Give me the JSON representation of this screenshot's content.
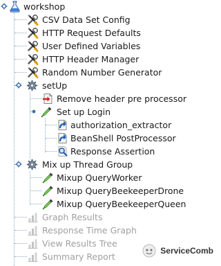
{
  "tree": {
    "root": {
      "label": "workshop",
      "icon": "flask-icon"
    },
    "items": [
      {
        "label": "CSV Data Set Config",
        "icon": "wrench-screwdriver-icon"
      },
      {
        "label": "HTTP Request Defaults",
        "icon": "wrench-screwdriver-icon"
      },
      {
        "label": "User Defined Variables",
        "icon": "wrench-screwdriver-icon"
      },
      {
        "label": "HTTP Header Manager",
        "icon": "wrench-screwdriver-icon"
      },
      {
        "label": "Random Number Generator",
        "icon": "wrench-screwdriver-icon"
      },
      {
        "label": "setUp",
        "icon": "gear-icon"
      },
      {
        "label": "Remove header pre processor",
        "icon": "preprocessor-icon"
      },
      {
        "label": "Set up Login",
        "icon": "pipette-sampler-icon"
      },
      {
        "label": "authorization_extractor",
        "icon": "postprocessor-arrow-icon"
      },
      {
        "label": "BeanShell PostProcessor",
        "icon": "postprocessor-arrow-icon"
      },
      {
        "label": "Response Assertion",
        "icon": "magnifier-icon"
      },
      {
        "label": "Mix up Thread Group",
        "icon": "gear-icon"
      },
      {
        "label": "Mixup QueryWorker",
        "icon": "pipette-sampler-icon"
      },
      {
        "label": "Mixup QueryBeekeeperDrone",
        "icon": "pipette-sampler-icon"
      },
      {
        "label": "Mixup QueryBeekeeperQueen",
        "icon": "pipette-sampler-icon"
      },
      {
        "label": "Graph Results",
        "icon": "chart-icon",
        "disabled": true
      },
      {
        "label": "Response Time Graph",
        "icon": "chart-icon",
        "disabled": true
      },
      {
        "label": "View Results Tree",
        "icon": "chart-icon",
        "disabled": true
      },
      {
        "label": "Summary Report",
        "icon": "chart-icon",
        "disabled": true
      }
    ]
  },
  "watermark": {
    "text": "ServiceComb",
    "icon": "servicecomb-logo-icon"
  },
  "colors": {
    "text": "#1a1a1a",
    "disabled_text": "#a0a0a0",
    "tree_line": "#8fa6bf",
    "expander": "#3b6ea5"
  }
}
